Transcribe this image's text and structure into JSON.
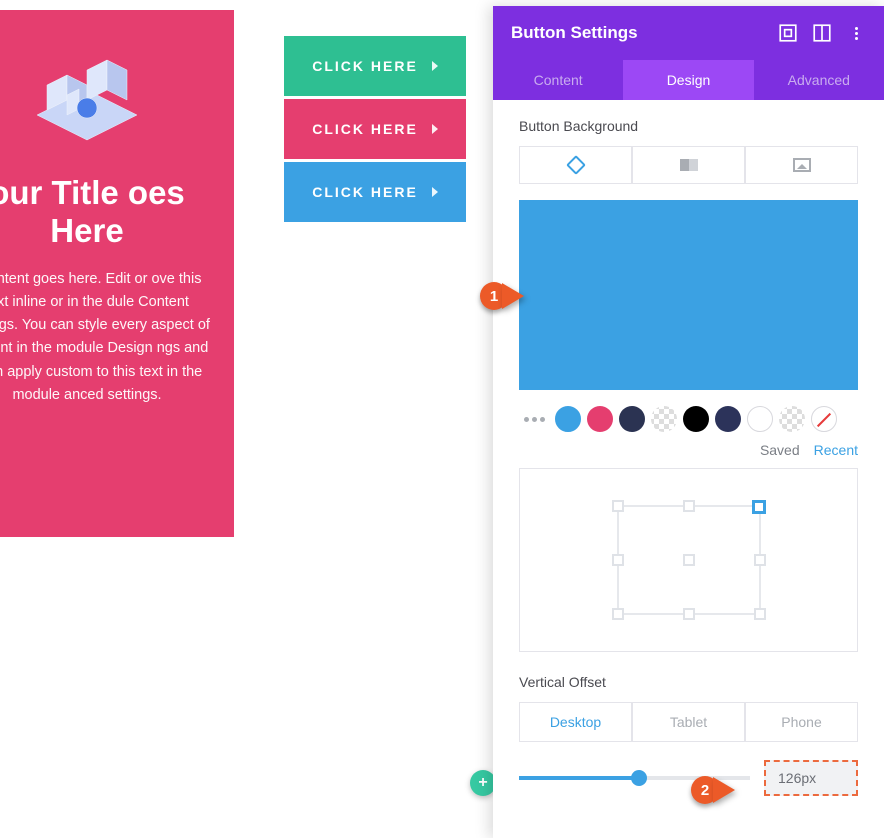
{
  "canvas": {
    "title": "our Title oes Here",
    "body": "r content goes here. Edit or ove this text inline or in the dule Content settings. You can style every aspect of this ent in the module Design ngs and even apply custom to this text in the module anced settings.",
    "buttons": [
      {
        "label": "CLICK HERE"
      },
      {
        "label": "CLICK HERE"
      },
      {
        "label": "CLICK HERE"
      }
    ]
  },
  "fab_plus": "+",
  "panel": {
    "title": "Button Settings",
    "tabs": {
      "content": "Content",
      "design": "Design",
      "advanced": "Advanced"
    },
    "bg_label": "Button Background",
    "swatches": [
      "#3ba1e3",
      "#e53e6f",
      "#2b3352",
      "transparent",
      "#000000",
      "#2c335a",
      "#ffffff",
      "transparent",
      "none"
    ],
    "saved": "Saved",
    "recent": "Recent",
    "offset_label": "Vertical Offset",
    "responsive": {
      "desktop": "Desktop",
      "tablet": "Tablet",
      "phone": "Phone"
    },
    "offset_value": "126px"
  },
  "callouts": {
    "one": "1",
    "two": "2"
  }
}
